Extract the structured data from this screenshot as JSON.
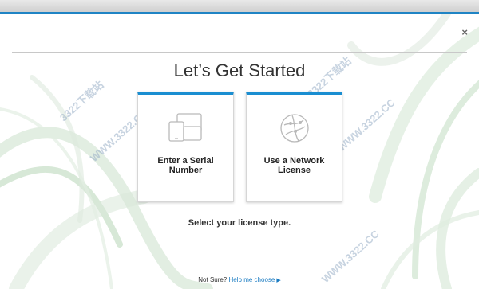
{
  "dialog": {
    "title": "Let’s Get Started",
    "close_symbol": "×",
    "subtitle": "Select your license type."
  },
  "options": [
    {
      "label": "Enter a Serial\nNumber",
      "icon": "devices-icon"
    },
    {
      "label": "Use a Network\nLicense",
      "icon": "network-globe-icon"
    }
  ],
  "footer": {
    "prefix": "Not Sure?",
    "link_label": "Help me choose",
    "arrow": "▶"
  },
  "watermark": {
    "text": "3322下载站",
    "url": "WWW.3322.CC"
  },
  "colors": {
    "accent": "#1a8ed1",
    "titlebar_line": "#1f84c4",
    "link": "#1a7bc2"
  }
}
